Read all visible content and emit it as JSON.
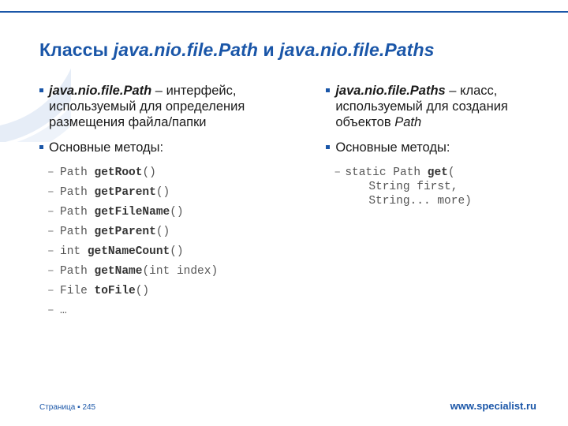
{
  "title": {
    "prefix": "Классы ",
    "class1": "java.nio.file.Path",
    "connector": " и ",
    "class2": "java.nio.file.Paths"
  },
  "left": {
    "intro": {
      "lead": "java.nio.file.Path",
      "rest": " – интерфейс, используемый для определения размещения файла/папки"
    },
    "methods_label": "Основные методы:",
    "methods": [
      {
        "ret": "Path ",
        "name": "getRoot",
        "args": "()"
      },
      {
        "ret": "Path ",
        "name": "getParent",
        "args": "()"
      },
      {
        "ret": "Path ",
        "name": "getFileName",
        "args": "()"
      },
      {
        "ret": "Path ",
        "name": "getParent",
        "args": "()"
      },
      {
        "ret": "int ",
        "name": "getNameCount",
        "args": "()"
      },
      {
        "ret": "Path ",
        "name": "getName",
        "args": "(int index)"
      },
      {
        "ret": "File ",
        "name": "toFile",
        "args": "()"
      },
      {
        "ret": "…",
        "name": "",
        "args": ""
      }
    ]
  },
  "right": {
    "intro": {
      "lead": "java.nio.file.Paths",
      "rest_a": " – класс, используемый для создания объектов ",
      "rest_ital": "Path"
    },
    "methods_label": "Основные методы:",
    "method": {
      "line1_pre": "static Path ",
      "line1_name": "get",
      "line1_post": "(",
      "line2": "String first,",
      "line3": "String... more)"
    }
  },
  "footer": {
    "page_label": "Страница",
    "page_sep": " ▪ ",
    "page_num": "245",
    "url": "www.specialist.ru"
  }
}
